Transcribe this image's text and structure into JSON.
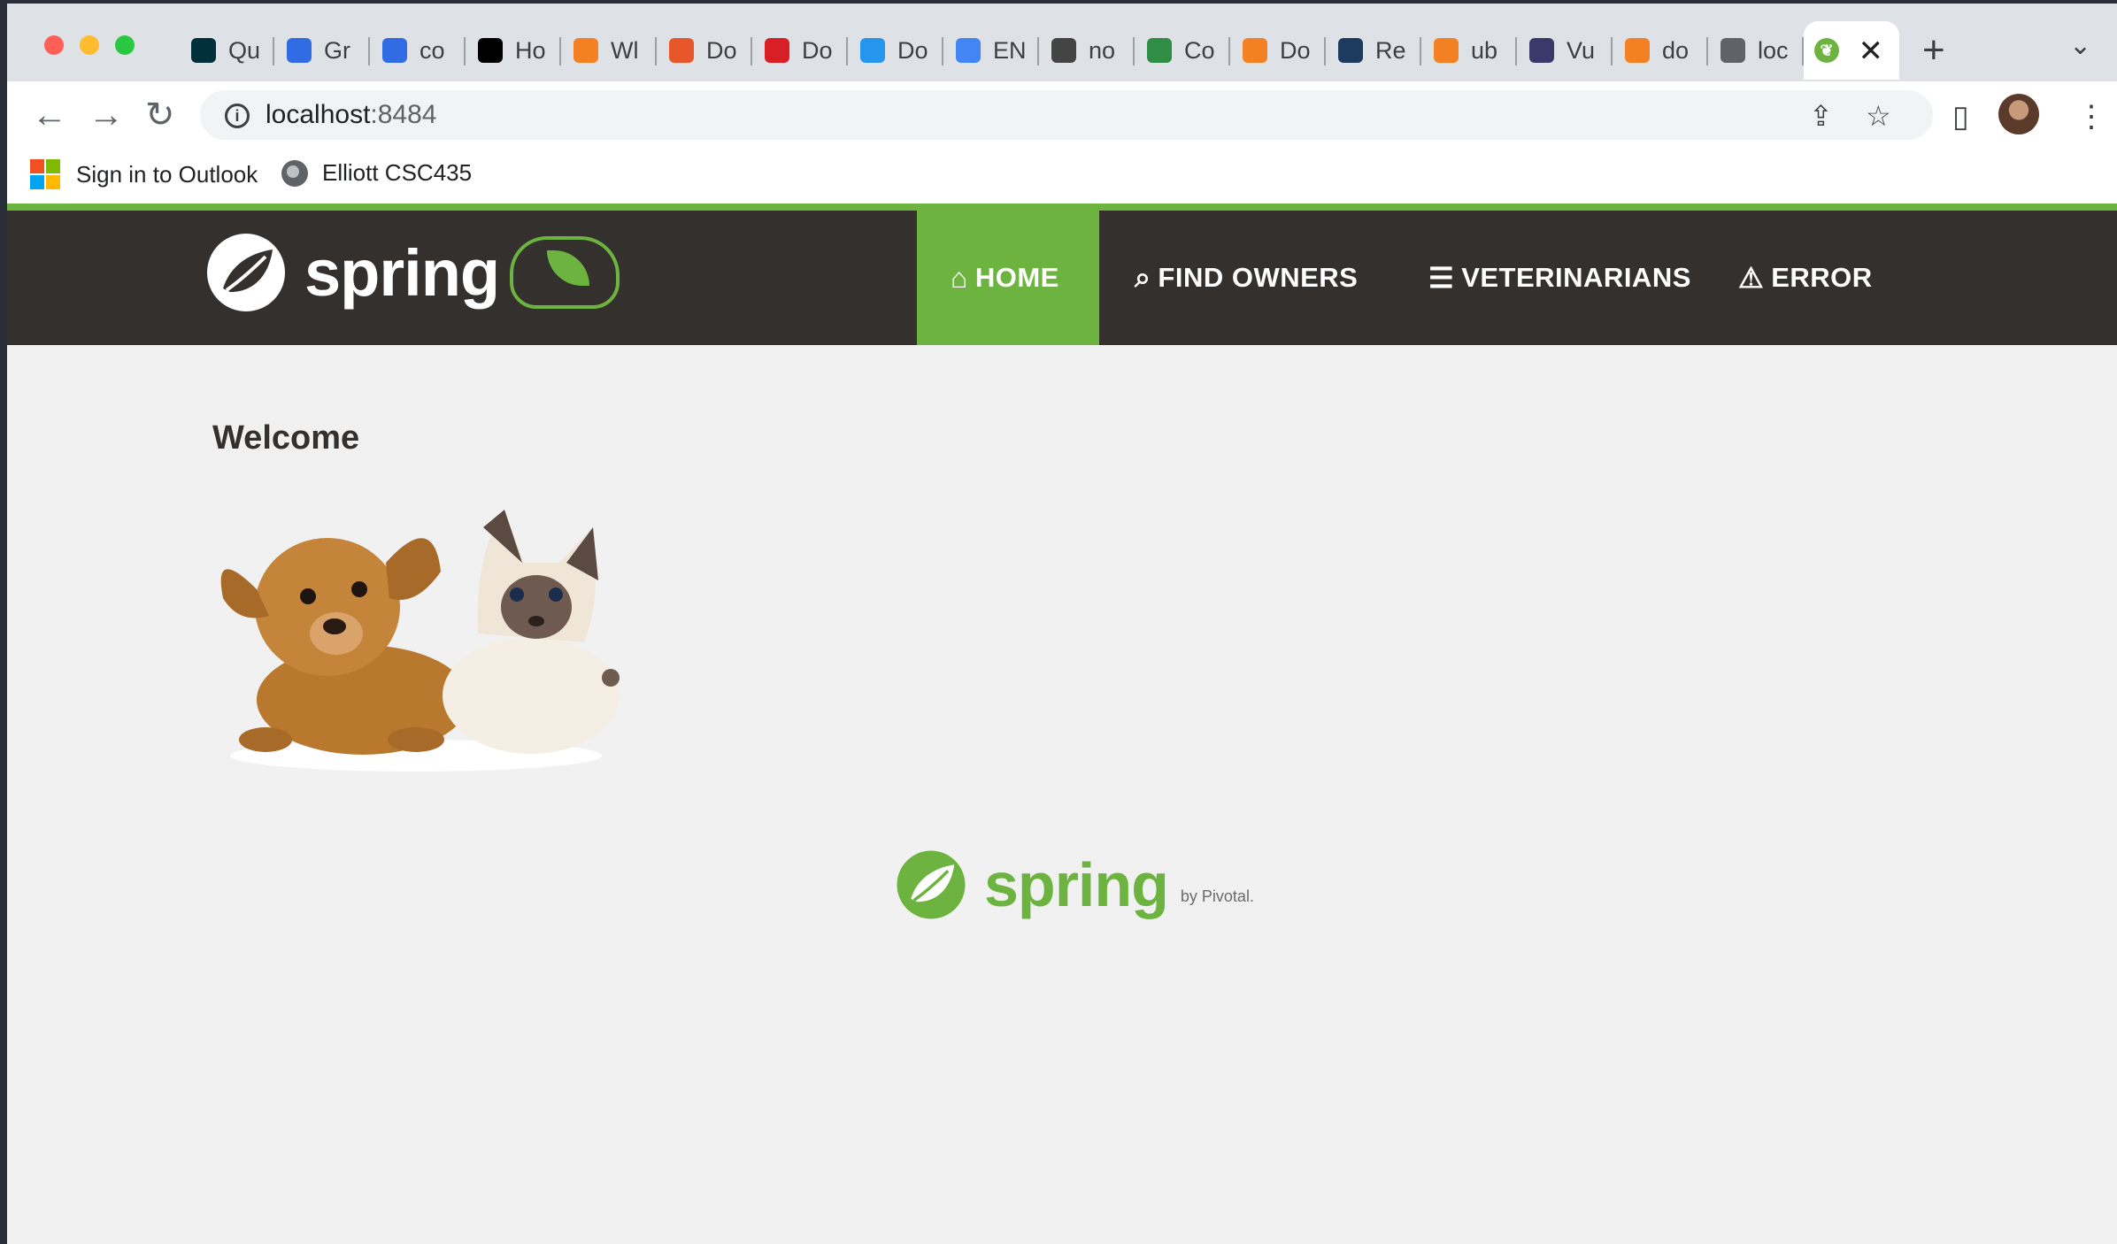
{
  "browser": {
    "tabs": [
      {
        "title": "Qu",
        "icon": "gradle-icon",
        "color": "#02303a"
      },
      {
        "title": "Gr",
        "icon": "kubernetes-icon",
        "color": "#326ce5"
      },
      {
        "title": "co",
        "icon": "kubernetes-icon",
        "color": "#326ce5"
      },
      {
        "title": "Ho",
        "icon": "medium-icon",
        "color": "#000000"
      },
      {
        "title": "Wl",
        "icon": "stackoverflow-icon",
        "color": "#f48024"
      },
      {
        "title": "Do",
        "icon": "bitbucket-icon",
        "color": "#e8572c"
      },
      {
        "title": "Do",
        "icon": "red-circle-icon",
        "color": "#d91f26"
      },
      {
        "title": "Do",
        "icon": "docker-icon",
        "color": "#2496ed"
      },
      {
        "title": "EN",
        "icon": "google-icon",
        "color": "#4285f4"
      },
      {
        "title": "no",
        "icon": "grid-icon",
        "color": "#444444"
      },
      {
        "title": "Co",
        "icon": "geeksforgeeks-icon",
        "color": "#2f8d46"
      },
      {
        "title": "Do",
        "icon": "stackoverflow-icon",
        "color": "#f48024"
      },
      {
        "title": "Re",
        "icon": "docker-circle-icon",
        "color": "#1d3a5f"
      },
      {
        "title": "ub",
        "icon": "stackoverflow-icon",
        "color": "#f48024"
      },
      {
        "title": "Vu",
        "icon": "castle-icon",
        "color": "#3a3a6a"
      },
      {
        "title": "do",
        "icon": "stackoverflow-icon",
        "color": "#f48024"
      },
      {
        "title": "loc",
        "icon": "globe-icon",
        "color": "#5f6368"
      }
    ],
    "active_tab": {
      "icon": "spring-icon",
      "color": "#6db33f"
    },
    "url_host": "localhost",
    "url_port": ":8484",
    "bookmarks": [
      {
        "label": "Sign in to Outlook",
        "icon": "microsoft-icon"
      },
      {
        "label": "Elliott CSC435",
        "icon": "globe-icon"
      }
    ]
  },
  "site": {
    "brand": "spring",
    "nav": [
      {
        "label": "HOME",
        "icon": "home-icon",
        "active": true
      },
      {
        "label": "FIND OWNERS",
        "icon": "search-icon",
        "active": false
      },
      {
        "label": "VETERINARIANS",
        "icon": "list-icon",
        "active": false
      },
      {
        "label": "ERROR",
        "icon": "warning-icon",
        "active": false
      }
    ],
    "welcome": "Welcome",
    "footer_brand": "spring",
    "footer_by": "by Pivotal.",
    "colors": {
      "accent": "#6db33f",
      "header": "#34302d",
      "background": "#f1f1f1"
    }
  }
}
